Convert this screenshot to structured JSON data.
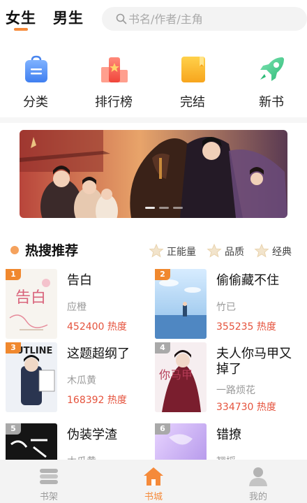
{
  "header": {
    "tabs": [
      {
        "label": "女生",
        "active": true
      },
      {
        "label": "男生",
        "active": false
      }
    ],
    "search_placeholder": "书名/作者/主角",
    "accent_color": "#f58a3a"
  },
  "shortcuts": [
    {
      "label": "分类",
      "icon": "category-bag-icon"
    },
    {
      "label": "排行榜",
      "icon": "ranking-podium-icon"
    },
    {
      "label": "完结",
      "icon": "finished-book-icon"
    },
    {
      "label": "新书",
      "icon": "new-book-rocket-icon"
    }
  ],
  "hot_search": {
    "title": "热搜推荐",
    "filters": [
      "正能量",
      "品质",
      "经典"
    ],
    "books": [
      {
        "rank": "1",
        "title": "告白",
        "author": "应橙",
        "heat": "452400 热度",
        "rank_color": "#f0882e"
      },
      {
        "rank": "2",
        "title": "偷偷藏不住",
        "author": "竹已",
        "heat": "355235 热度",
        "rank_color": "#f0882e"
      },
      {
        "rank": "3",
        "title": "这题超纲了",
        "author": "木瓜黄",
        "heat": "168392 热度",
        "rank_color": "#f0882e"
      },
      {
        "rank": "4",
        "title": "夫人你马甲又掉了",
        "author": "一路烦花",
        "heat": "334730 热度",
        "rank_color": "#a9a9a9"
      },
      {
        "rank": "5",
        "title": "伪装学渣",
        "author": "木瓜黄",
        "heat": "",
        "rank_color": "#a9a9a9"
      },
      {
        "rank": "6",
        "title": "错撩",
        "author": "翘摇",
        "heat": "",
        "rank_color": "#a9a9a9"
      }
    ],
    "cover_texts": {
      "book1": "告白",
      "book3": "OUTLINE",
      "book4": "你马甲"
    }
  },
  "bottom_nav": [
    {
      "label": "书架",
      "icon": "bookshelf-icon",
      "active": false
    },
    {
      "label": "书城",
      "icon": "home-icon",
      "active": true
    },
    {
      "label": "我的",
      "icon": "profile-icon",
      "active": false
    }
  ]
}
